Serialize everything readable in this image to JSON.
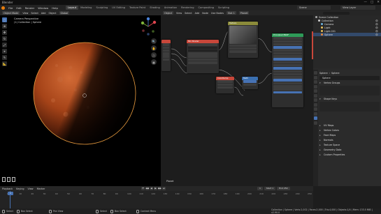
{
  "app": {
    "window_title": "Blender",
    "window_controls": [
      "—",
      "□",
      "✕"
    ]
  },
  "menu": {
    "items": [
      "File",
      "Edit",
      "Render",
      "Window",
      "Help"
    ],
    "workspaces": [
      "Layout",
      "Modeling",
      "Sculpting",
      "UV Editing",
      "Texture Paint",
      "Shading",
      "Animation",
      "Rendering",
      "Compositing",
      "Scripting"
    ],
    "active_workspace": "Layout",
    "scene": "Scene",
    "view_layer": "View Layer"
  },
  "viewport": {
    "mode": "Object Mode",
    "menus": [
      "View",
      "Select",
      "Add",
      "Object"
    ],
    "orientation": "Global",
    "perspective_label": "Camera Perspective",
    "collection_label": "(1) Collection | Sphere",
    "overlay_letter": "G",
    "tools": [
      "select-tool",
      "cursor-tool",
      "move-tool",
      "rotate-tool",
      "scale-tool",
      "transform-tool",
      "annotate-tool",
      "measure-tool"
    ]
  },
  "node_editor": {
    "type": "Object",
    "menus": [
      "View",
      "Select",
      "Add",
      "Node"
    ],
    "use_nodes_label": "Use Nodes",
    "slot": "Slot 1",
    "material": "Planet",
    "footer_label": "Planet",
    "nodes": [
      {
        "title": "",
        "header_color": "#c8473a"
      },
      {
        "title": "Mix Shader",
        "header_color": "#c8473a"
      },
      {
        "title": "Texture",
        "header_color": "#8b8b3a"
      },
      {
        "title": "Principled BSDF",
        "header_color": "#2e9a58"
      },
      {
        "title": "ColorRamp",
        "header_color": "#c8473a"
      },
      {
        "title": "Math",
        "header_color": "#3a6fb0"
      }
    ]
  },
  "outliner": {
    "title": "Scene Collection",
    "rows": [
      {
        "label": "Scene Collection",
        "color": "#aaaaaa",
        "selected": false
      },
      {
        "label": "Collection",
        "color": "#cfcfcf",
        "selected": false
      },
      {
        "label": "Camera",
        "color": "#6fb5e0",
        "selected": false
      },
      {
        "label": "Light",
        "color": "#e6c15c",
        "selected": false
      },
      {
        "label": "Light.001",
        "color": "#e6c15c",
        "selected": false
      },
      {
        "label": "Sphere",
        "color": "#e88a3a",
        "selected": true
      }
    ]
  },
  "properties": {
    "object_name": "Sphere",
    "data_name": "Sphere",
    "mesh_name": "Sphere",
    "sections": [
      "Vertex Groups",
      "Shape Keys",
      "UV Maps",
      "Vertex Colors",
      "Face Maps",
      "Normals",
      "Texture Space",
      "Geometry Data",
      "Custom Properties"
    ]
  },
  "timeline": {
    "menus": [
      "Playback",
      "Keying",
      "View",
      "Marker"
    ],
    "current_frame": "1",
    "start_label": "Start",
    "start": "1",
    "end_label": "End",
    "end": "250",
    "ruler_ticks": [
      "0",
      "10",
      "20",
      "30",
      "40",
      "50",
      "60",
      "70",
      "80",
      "90",
      "100",
      "110",
      "120",
      "130",
      "140",
      "150",
      "160",
      "170",
      "180",
      "190",
      "200",
      "210",
      "220",
      "230",
      "240",
      "250"
    ]
  },
  "statusbar": {
    "left_action": "Select",
    "left_action2": "Box Select",
    "mid_action": "Pan View",
    "right_action": "Select",
    "right_action2": "Box Select",
    "right_action3": "Pan View",
    "context_menu": "Context Menu",
    "stats": "Collection | Sphere | Verts:2,002 | Faces:2,000 | Tris:4,000 | Objects:1/4 | Mem: 133.5 MiB | v2.90.0"
  },
  "colors": {
    "accent": "#4772b3",
    "blender_orange": "#e87d0d",
    "planet_base": "#b04a1c",
    "selection_outline": "#f0a040"
  }
}
